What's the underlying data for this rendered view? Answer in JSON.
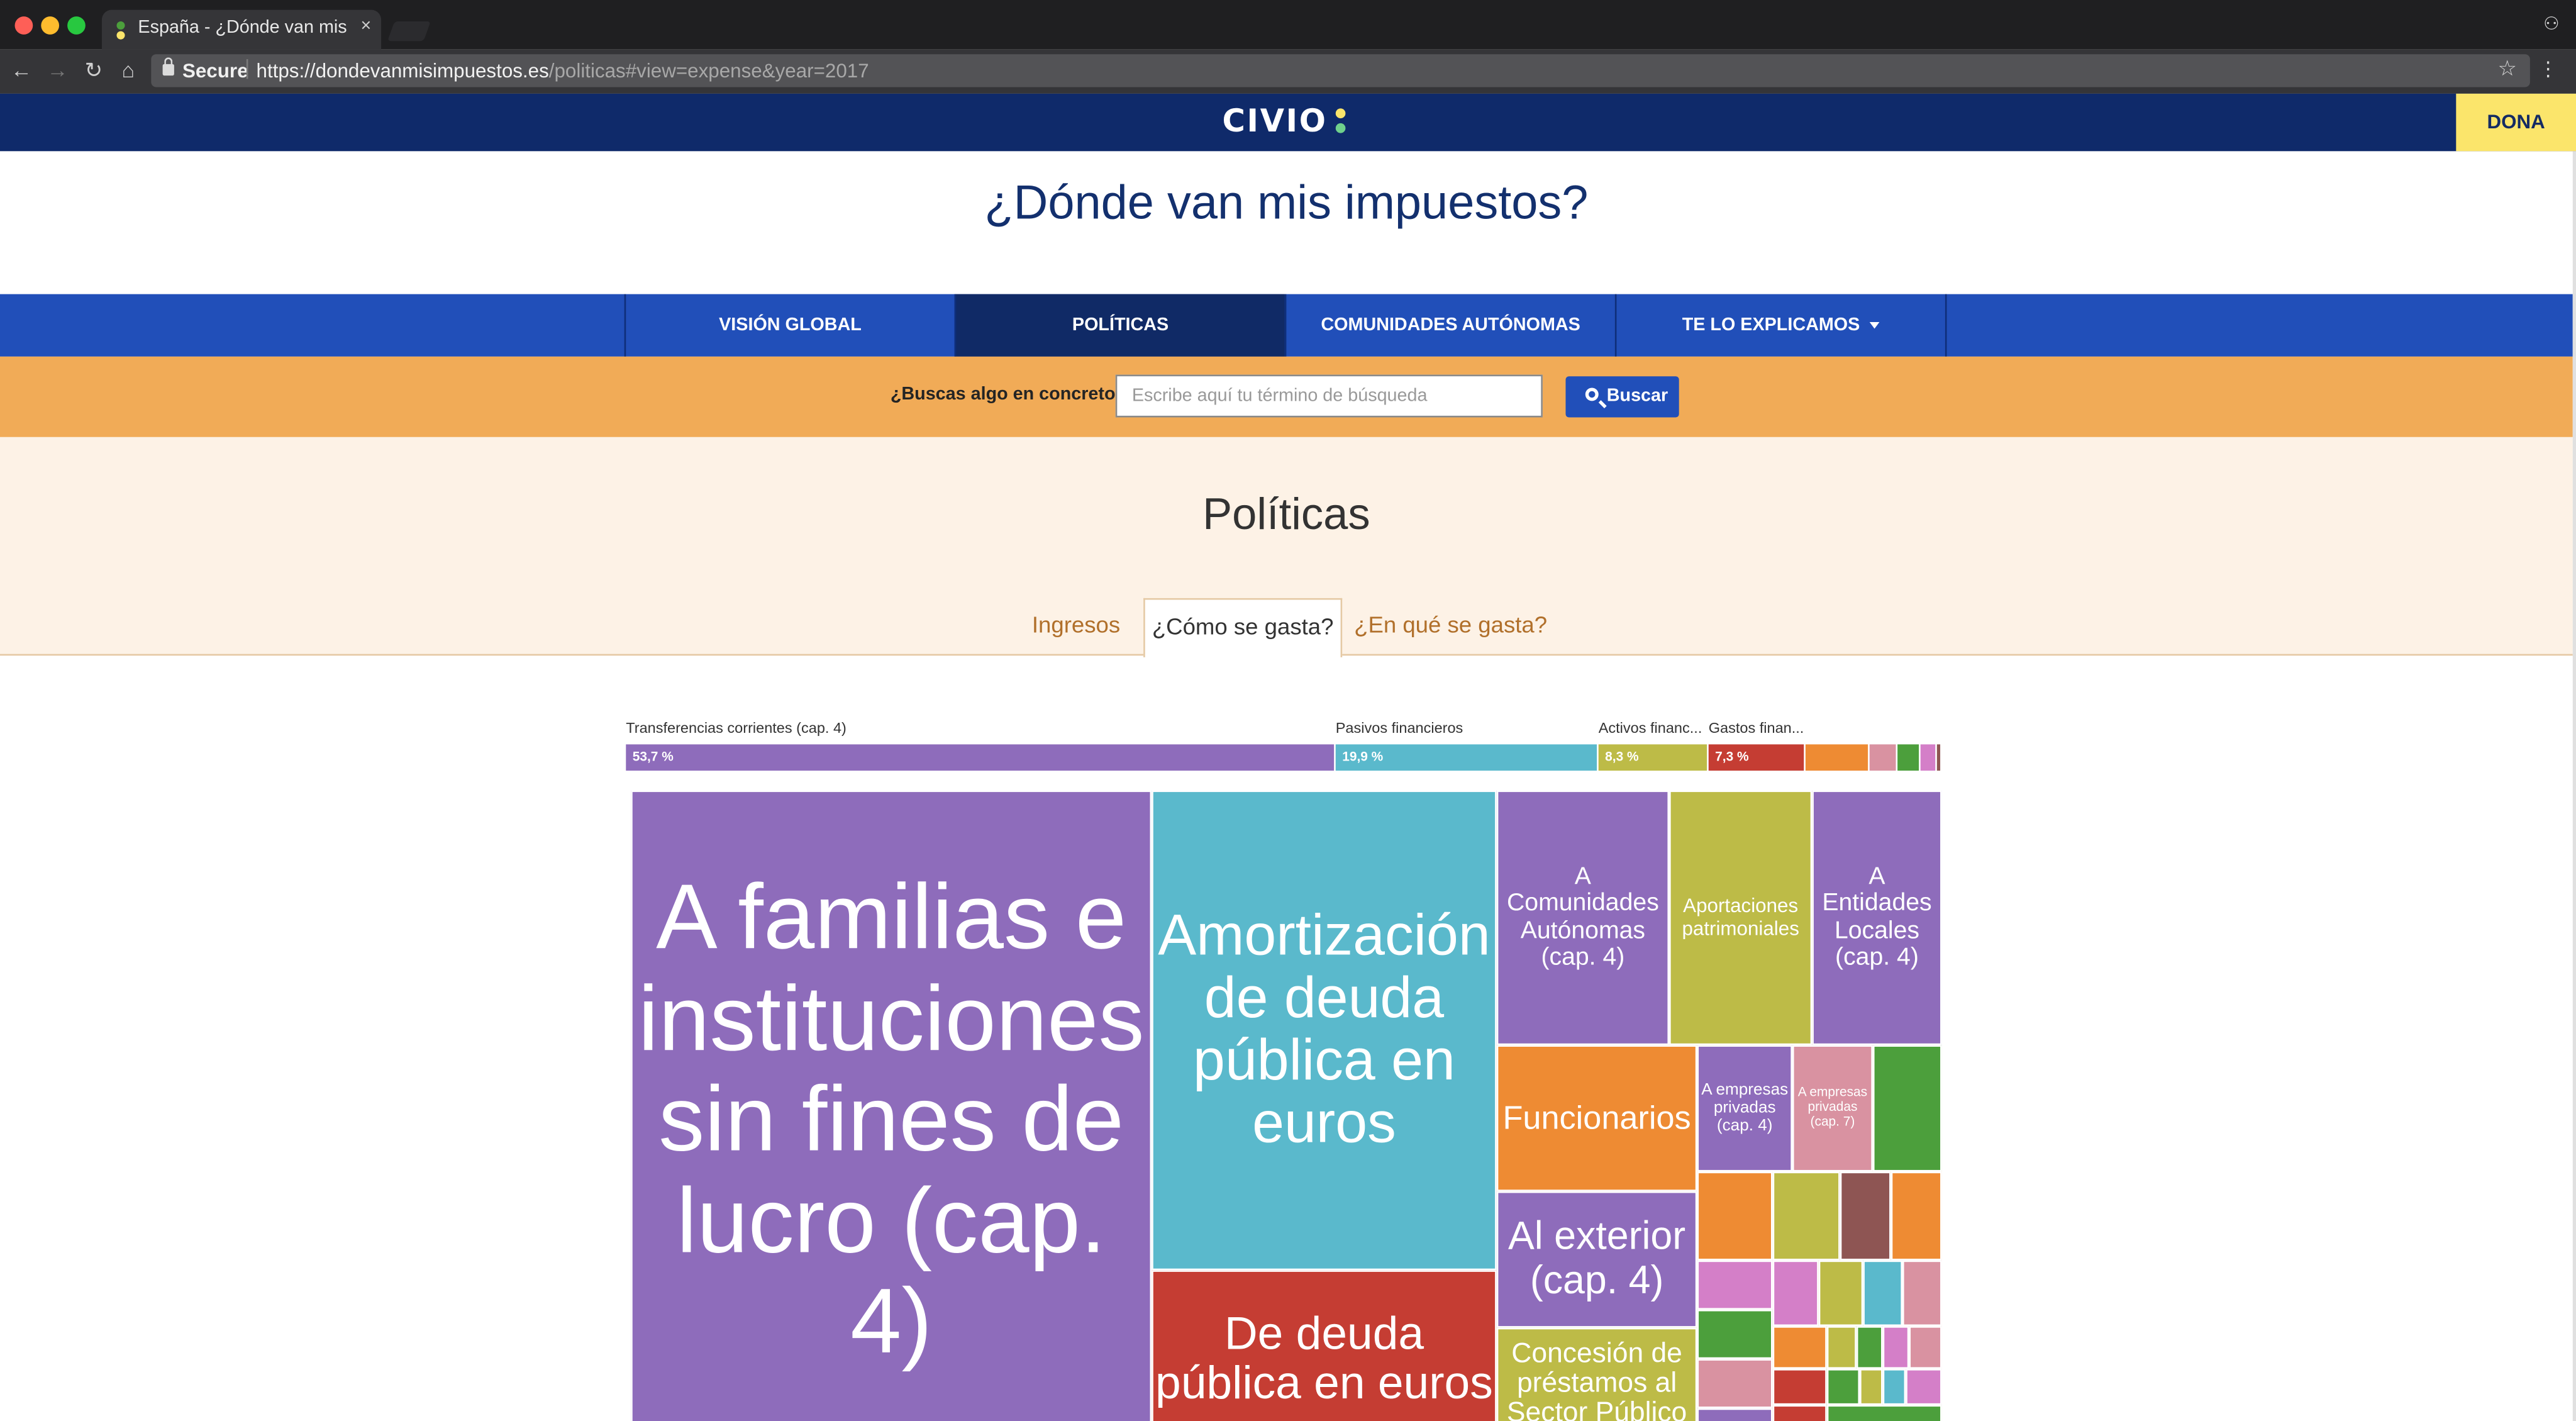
{
  "browser": {
    "tab_title": "España - ¿Dónde van mis impuestos?",
    "tab_close": "×",
    "secure_label": "Secure",
    "url_host": "https://dondevanmisimpuestos.es",
    "url_path": "/politicas#view=expense&year=2017",
    "back_icon": "←",
    "forward_icon": "→",
    "reload_icon": "↻",
    "home_icon": "⌂",
    "star_icon": "☆",
    "menu_icon": "⋮",
    "profile_icon": "⚇"
  },
  "header": {
    "logo_text": "CIVIO",
    "donate_label": "DONA",
    "site_title": "¿Dónde van mis impuestos?"
  },
  "nav": {
    "items": [
      {
        "label": "VISIÓN GLOBAL"
      },
      {
        "label": "POLÍTICAS"
      },
      {
        "label": "COMUNIDADES AUTÓNOMAS"
      },
      {
        "label": "TE LO EXPLICAMOS"
      }
    ]
  },
  "search": {
    "label": "¿Buscas algo en concreto?",
    "placeholder": "Escribe aquí tu término de búsqueda",
    "button_label": "Buscar"
  },
  "section": {
    "title": "Políticas",
    "tabs": [
      {
        "label": "Ingresos"
      },
      {
        "label": "¿Cómo se gasta?"
      },
      {
        "label": "¿En qué se gasta?"
      }
    ]
  },
  "colors": {
    "navy": "#0f2a6a",
    "nav_blue": "#214fb9",
    "orange_band": "#f1ab57",
    "cream": "#fdf2e6",
    "donate_yellow": "#fbe56b",
    "purple": "#8e6cbb",
    "cyan": "#5ab9cc",
    "olive": "#bdbb47",
    "red": "#c53d33",
    "orange": "#ee8b33",
    "pink": "#d992a1",
    "green": "#4c9f3c",
    "brown": "#8e5553",
    "magenta": "#d47fc8"
  },
  "breakdown": {
    "segments": [
      {
        "label": "Transferencias corrientes (cap. 4)",
        "pct_text": "53,7 %",
        "value": 53.7,
        "color": "#8e6cbb"
      },
      {
        "label": "Pasivos financieros",
        "pct_text": "19,9 %",
        "value": 19.9,
        "color": "#5ab9cc"
      },
      {
        "label": "Activos financ...",
        "pct_text": "8,3 %",
        "value": 8.3,
        "color": "#bdbb47"
      },
      {
        "label": "Gastos finan...",
        "pct_text": "7,3 %",
        "value": 7.3,
        "color": "#c53d33"
      },
      {
        "label": "",
        "pct_text": "",
        "value": 4.8,
        "color": "#ee8b33"
      },
      {
        "label": "",
        "pct_text": "",
        "value": 2.1,
        "color": "#d992a1"
      },
      {
        "label": "",
        "pct_text": "",
        "value": 1.8,
        "color": "#4c9f3c"
      },
      {
        "label": "",
        "pct_text": "",
        "value": 1.3,
        "color": "#d47fc8"
      },
      {
        "label": "",
        "pct_text": "",
        "value": 0.4,
        "color": "#8e5553"
      }
    ]
  },
  "treemap": {
    "tiles": [
      {
        "name": "A familias e instituciones sin fines de lucro (cap. 4)",
        "label": "A familias e instituciones sin fines de lucro (cap. 4)",
        "color": "#8e6cbb"
      },
      {
        "name": "Amortización de deuda pública en euros",
        "label": "Amortización de deuda pública en euros",
        "color": "#5ab9cc"
      },
      {
        "name": "De deuda pública en euros",
        "label": "De deuda pública en euros",
        "color": "#c53d33"
      },
      {
        "name": "A Comunidades Autónomas (cap. 4)",
        "label": "A Comunidades Autónomas (cap. 4)",
        "color": "#8e6cbb"
      },
      {
        "name": "Aportaciones patrimoniales",
        "label": "Aportaciones patrimoniales",
        "color": "#bdbb47"
      },
      {
        "name": "A Entidades Locales (cap. 4)",
        "label": "A Entidades Locales (cap. 4)",
        "color": "#8e6cbb"
      },
      {
        "name": "Funcionarios",
        "label": "Funcionarios",
        "color": "#ee8b33"
      },
      {
        "name": "A empresas privadas (cap. 4)",
        "label": "A empresas privadas (cap. 4)",
        "color": "#8e6cbb"
      },
      {
        "name": "A empresas privadas (cap. 7)",
        "label": "A empresas privadas (cap. 7)",
        "color": "#d992a1"
      },
      {
        "name": "Al exterior (cap. 4)",
        "label": "Al exterior (cap. 4)",
        "color": "#8e6cbb"
      },
      {
        "name": "Concesión de préstamos al Sector Público",
        "label": "Concesión de préstamos al Sector Público",
        "color": "#bdbb47"
      }
    ],
    "small_tile_colors": [
      "#4c9f3c",
      "#ee8b33",
      "#bdbb47",
      "#8e5553",
      "#ee8b33",
      "#d47fc8",
      "#d47fc8",
      "#bdbb47",
      "#5ab9cc",
      "#d992a1",
      "#4c9f3c",
      "#d992a1",
      "#ee8b33",
      "#bdbb47",
      "#4c9f3c",
      "#d47fc8",
      "#d992a1",
      "#8e6cbb",
      "#c53d33",
      "#4c9f3c",
      "#bdbb47",
      "#5ab9cc",
      "#d47fc8",
      "#c53d33",
      "#4c9f3c"
    ]
  }
}
